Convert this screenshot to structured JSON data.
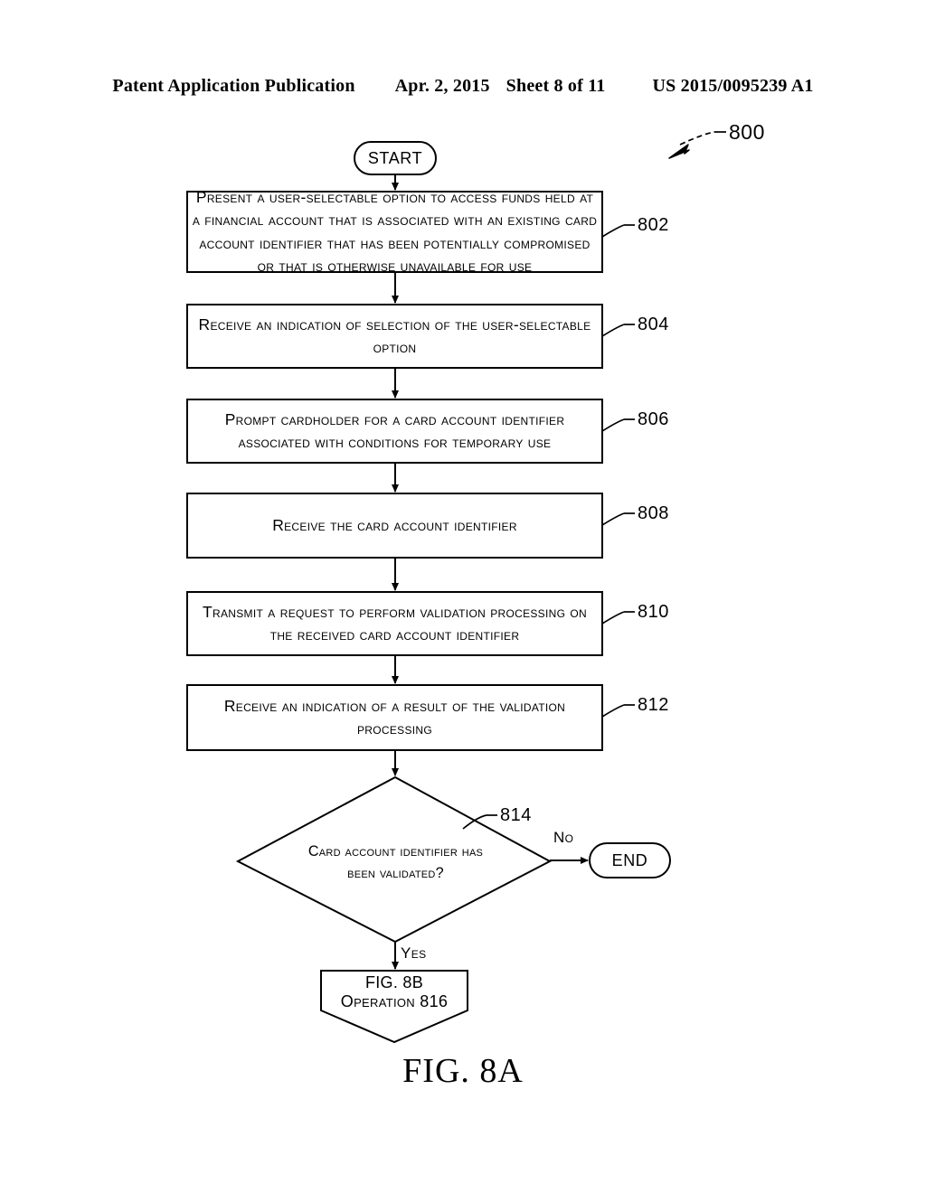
{
  "header": {
    "publication": "Patent Application Publication",
    "date": "Apr. 2, 2015",
    "sheet": "Sheet 8 of 11",
    "patent_number": "US 2015/0095239 A1"
  },
  "figure": {
    "caption": "FIG. 8A",
    "diagram_ref": "800",
    "start_label": "START",
    "end_label": "END",
    "yes_label": "Yes",
    "no_label": "No",
    "line_color": "#000000",
    "background_color": "#ffffff"
  },
  "steps": [
    {
      "ref": "802",
      "lines": [
        "Present a user-selectable option to access funds held at",
        "a financial account that is associated with an existing card",
        "account identifier that has been potentially compromised",
        "or that is otherwise unavailable for use"
      ]
    },
    {
      "ref": "804",
      "lines": [
        "Receive an indication of selection of the user-selectable",
        "option"
      ]
    },
    {
      "ref": "806",
      "lines": [
        "Prompt cardholder for a card account identifier",
        "associated with conditions for temporary use"
      ]
    },
    {
      "ref": "808",
      "lines": [
        "Receive the card account identifier"
      ]
    },
    {
      "ref": "810",
      "lines": [
        "Transmit a request to perform validation processing on",
        "the received card account identifier"
      ]
    },
    {
      "ref": "812",
      "lines": [
        "Receive an indication of a result of the validation",
        "processing"
      ]
    }
  ],
  "decision": {
    "ref": "814",
    "lines": [
      "Card account identifier has",
      "been validated?"
    ]
  },
  "offpage": {
    "line1": "FIG. 8B",
    "line2": "Operation 816"
  }
}
